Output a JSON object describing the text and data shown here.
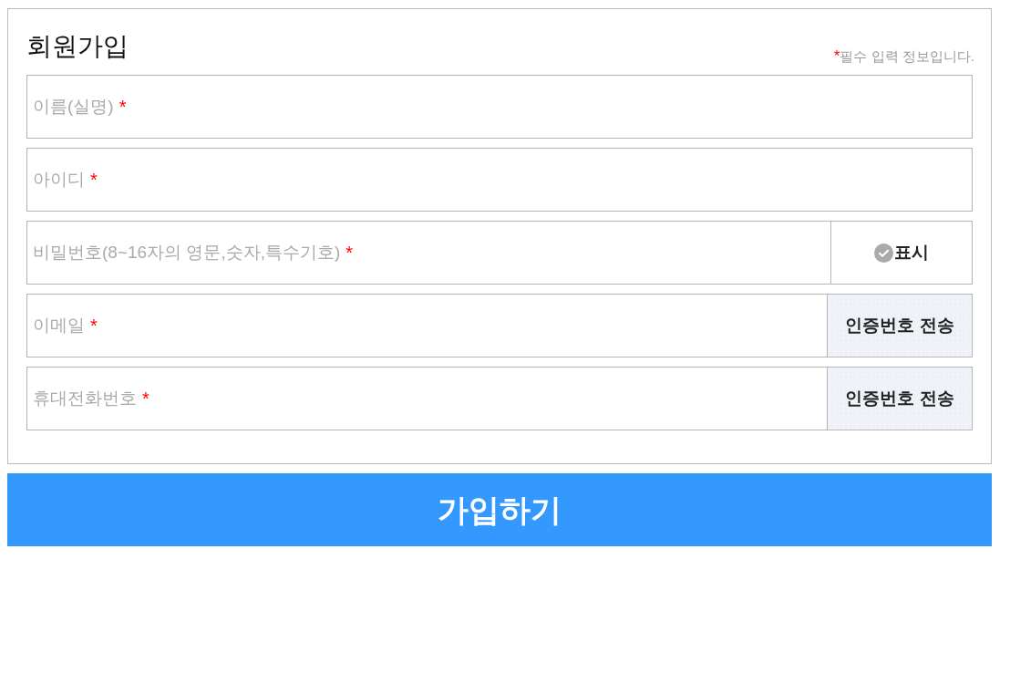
{
  "title": "회원가입",
  "required_note": {
    "mark": "*",
    "text": "필수 입력 정보입니다."
  },
  "fields": [
    {
      "kind": "plain",
      "placeholder": "이름(실명)",
      "required_mark": "*"
    },
    {
      "kind": "plain",
      "placeholder": "아이디",
      "required_mark": "*"
    },
    {
      "kind": "toggle",
      "placeholder": "비밀번호(8~16자의 영문,숫자,특수기호)",
      "required_mark": "*",
      "toggle": {
        "label": "표시",
        "checked": false
      }
    },
    {
      "kind": "action",
      "placeholder": "이메일",
      "required_mark": "*",
      "action": "인증번호 전송"
    },
    {
      "kind": "action",
      "placeholder": "휴대전화번호",
      "required_mark": "*",
      "action": "인증번호 전송"
    }
  ],
  "submit": "가입하기"
}
